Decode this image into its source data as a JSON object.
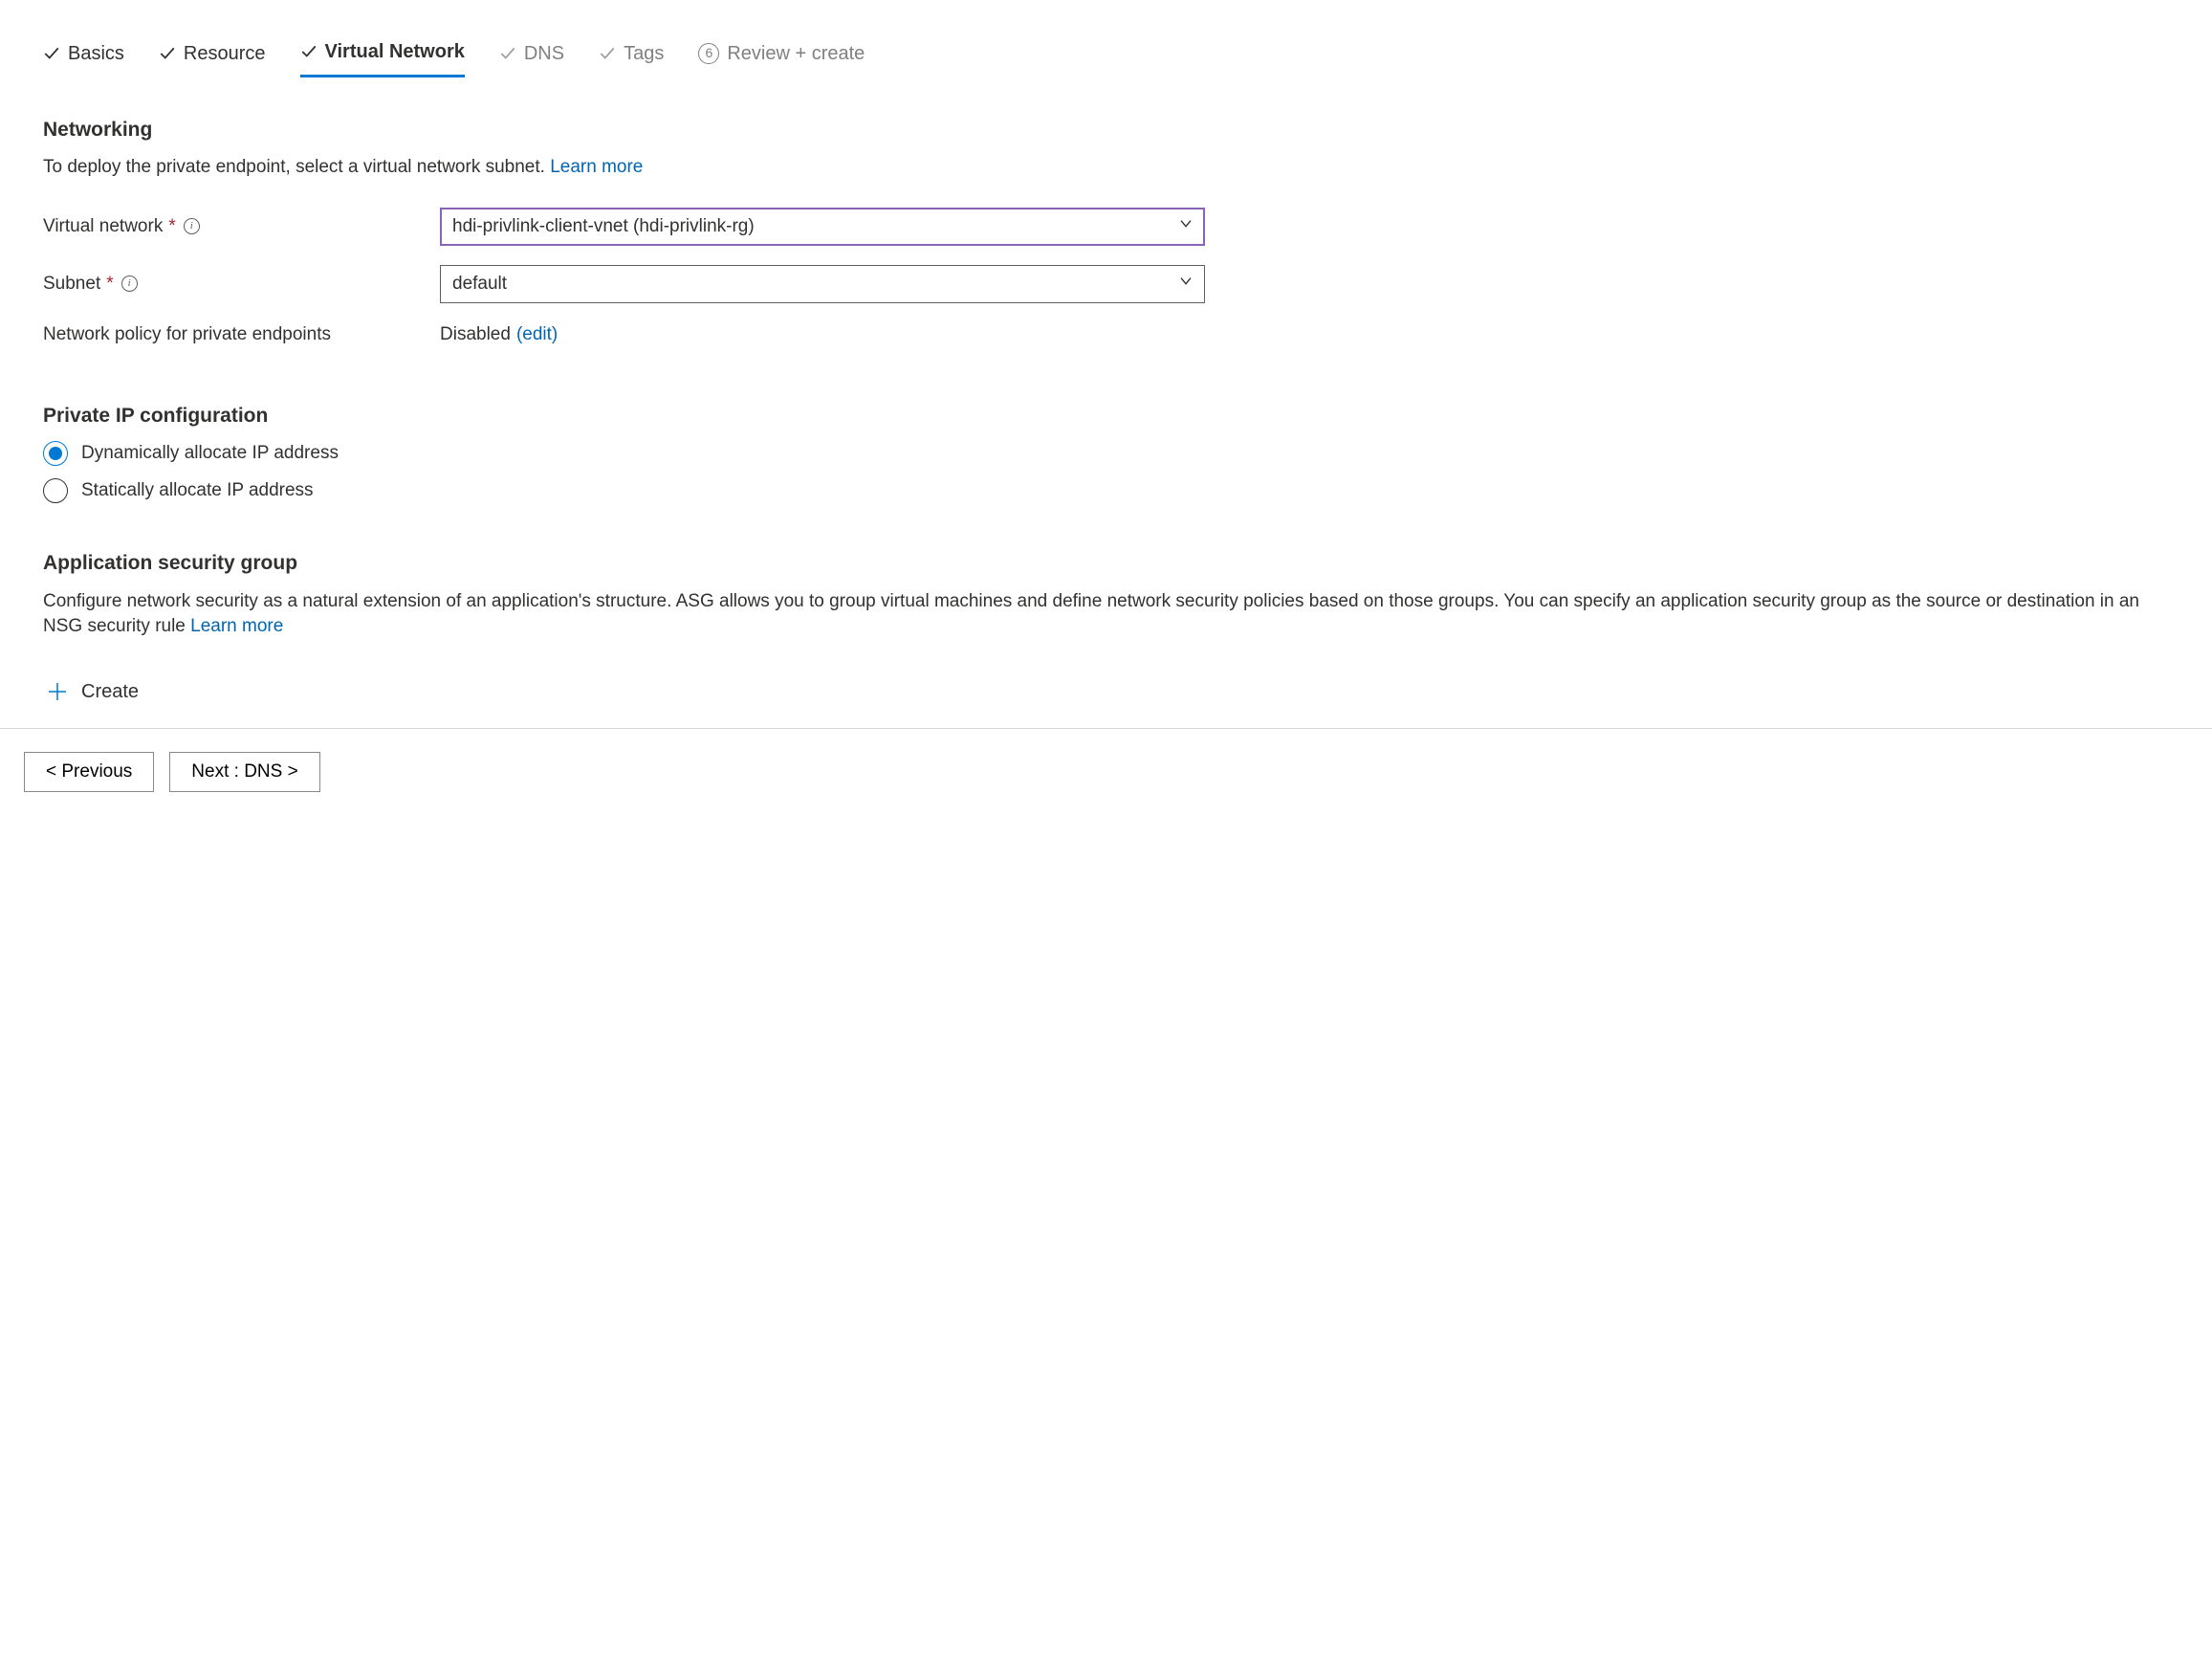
{
  "tabs": {
    "basics": "Basics",
    "resource": "Resource",
    "virtual_network": "Virtual Network",
    "dns": "DNS",
    "tags": "Tags",
    "review": "Review + create",
    "review_step": "6"
  },
  "networking": {
    "heading": "Networking",
    "desc": "To deploy the private endpoint, select a virtual network subnet.  ",
    "learn_more": "Learn more",
    "vnet_label": "Virtual network",
    "vnet_value": "hdi-privlink-client-vnet (hdi-privlink-rg)",
    "subnet_label": "Subnet",
    "subnet_value": "default",
    "policy_label": "Network policy for private endpoints",
    "policy_value": "Disabled",
    "policy_edit": "(edit)"
  },
  "private_ip": {
    "heading": "Private IP configuration",
    "opt_dynamic": "Dynamically allocate IP address",
    "opt_static": "Statically allocate IP address"
  },
  "asg": {
    "heading": "Application security group",
    "desc": "Configure network security as a natural extension of an application's structure. ASG allows you to group virtual machines and define network security policies based on those groups. You can specify an application security group as the source or destination in an NSG security rule  ",
    "learn_more": "Learn more",
    "create": "Create"
  },
  "footer": {
    "previous": "< Previous",
    "next": "Next : DNS >"
  }
}
